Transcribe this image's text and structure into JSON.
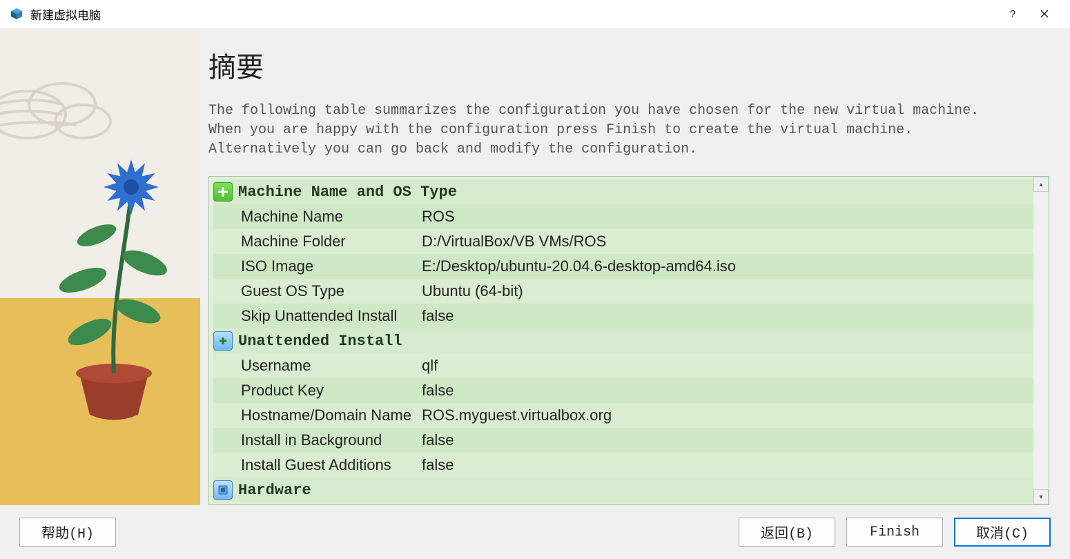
{
  "window": {
    "title": "新建虚拟电脑"
  },
  "heading": "摘要",
  "description": "The following table summarizes the configuration you have chosen for the new virtual machine. When you are happy with the configuration press Finish to create the virtual machine. Alternatively you can go back and modify the configuration.",
  "groups": [
    {
      "title": "Machine Name and OS Type",
      "icon": "green-plus",
      "rows": [
        {
          "label": "Machine Name",
          "value": "ROS"
        },
        {
          "label": "Machine Folder",
          "value": "D:/VirtualBox/VB VMs/ROS"
        },
        {
          "label": "ISO Image",
          "value": "E:/Desktop/ubuntu-20.04.6-desktop-amd64.iso"
        },
        {
          "label": "Guest OS Type",
          "value": "Ubuntu (64-bit)"
        },
        {
          "label": "Skip Unattended Install",
          "value": "false"
        }
      ]
    },
    {
      "title": "Unattended Install",
      "icon": "blue-plus",
      "rows": [
        {
          "label": "Username",
          "value": "qlf"
        },
        {
          "label": "Product Key",
          "value": "false"
        },
        {
          "label": "Hostname/Domain Name",
          "value": "ROS.myguest.virtualbox.org"
        },
        {
          "label": "Install in Background",
          "value": "false"
        },
        {
          "label": "Install Guest Additions",
          "value": "false"
        }
      ]
    },
    {
      "title": "Hardware",
      "icon": "chip",
      "rows": []
    }
  ],
  "buttons": {
    "help": "帮助(H)",
    "back": "返回(B)",
    "finish": "Finish",
    "cancel": "取消(C)"
  }
}
